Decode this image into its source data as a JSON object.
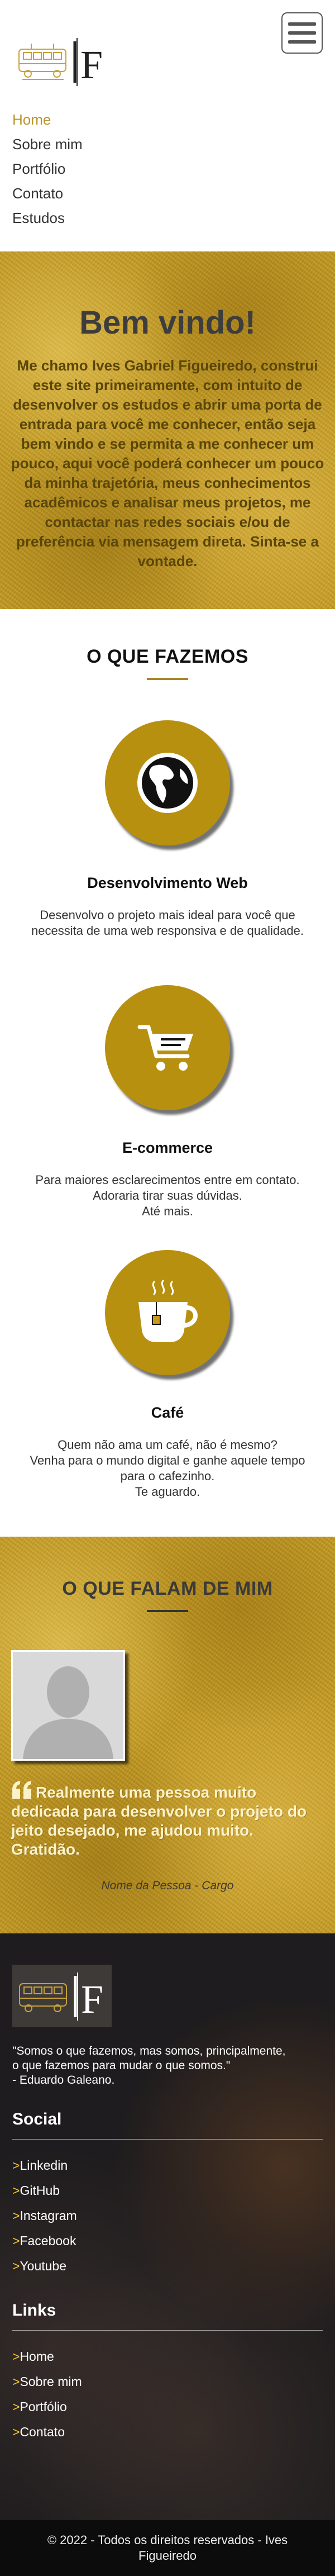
{
  "header": {
    "logo_alt": "IF",
    "menu_toggle_icon": "hamburger-icon"
  },
  "nav": {
    "items": [
      {
        "label": "Home"
      },
      {
        "label": "Sobre mim"
      },
      {
        "label": "Portfólio"
      },
      {
        "label": "Contato"
      },
      {
        "label": "Estudos"
      }
    ]
  },
  "welcome": {
    "title": "Bem vindo!",
    "text": "Me chamo Ives Gabriel Figueiredo, construi este site primeiramente, com intuito de desenvolver os estudos e abrir uma porta de entrada para você me conhecer, então seja bem vindo e se permita a me conhecer um pouco, aqui você poderá conhecer um pouco da minha trajetória, meus conhecimentos acadêmicos e analisar meus projetos, me contactar nas redes sociais e/ou de preferência via mensagem direta. Sinta-se a vontade."
  },
  "services": {
    "title": "O QUE FAZEMOS",
    "items": [
      {
        "icon": "globe-icon",
        "title": "Desenvolvimento Web",
        "text": "Desenvolvo o projeto mais ideal para você que\nnecessita de uma web responsiva e de qualidade."
      },
      {
        "icon": "shopping-cart-icon",
        "title": "E-commerce",
        "text": "Para maiores esclarecimentos entre em contato.\nAdoraria tirar suas dúvidas.\nAté mais."
      },
      {
        "icon": "coffee-cup-icon",
        "title": "Café",
        "text": "Quem não ama um café, não é mesmo?\nVenha para o mundo digital e ganhe aquele tempo\npara o cafezinho.\nTe aguardo."
      }
    ]
  },
  "testimonials": {
    "title": "O QUE FALAM DE MIM",
    "quote": "Realmente uma pessoa muito dedicada para desenvolver o projeto do jeito desejado, me ajudou muito. Gratidão.",
    "person": "Nome da Pessoa - Cargo"
  },
  "footer": {
    "motto": "\"Somos o que fazemos, mas somos, principalmente,\no que fazemos para mudar o que somos.\"\n- Eduardo Galeano.",
    "social_title": "Social",
    "social_links": [
      {
        "label": "Linkedin"
      },
      {
        "label": "GitHub"
      },
      {
        "label": "Instagram"
      },
      {
        "label": "Facebook"
      },
      {
        "label": "Youtube"
      }
    ],
    "links_title": "Links",
    "links": [
      {
        "label": "Home"
      },
      {
        "label": "Sobre mim"
      },
      {
        "label": "Portfólio"
      },
      {
        "label": "Contato"
      }
    ],
    "link_prefix": ">",
    "copyright": "© 2022 - Todos os direitos reservados - Ives Figueiredo"
  },
  "colors": {
    "accent": "#b8962e",
    "gold": "#c49a1f",
    "circle": "#b8900f",
    "footer_bg": "#1e1c1e",
    "chevron": "#f2c233"
  }
}
